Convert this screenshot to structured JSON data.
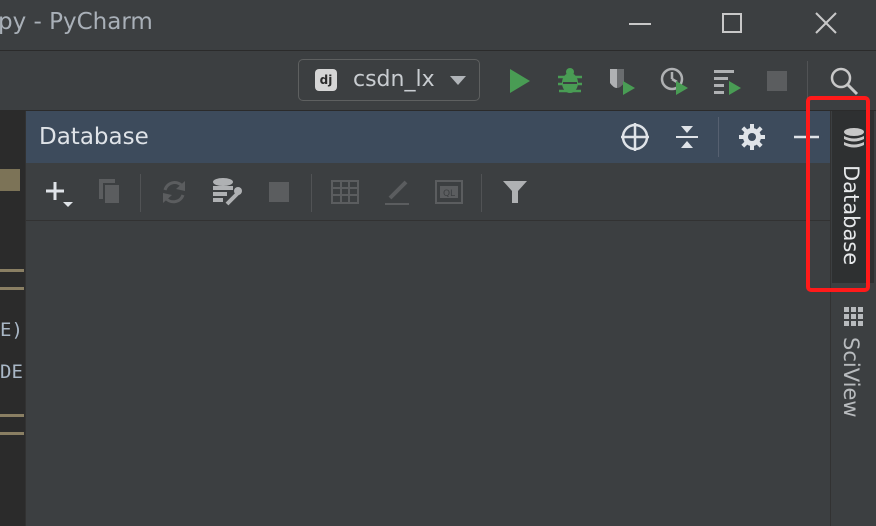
{
  "window": {
    "title": "py - PyCharm"
  },
  "navbar": {
    "run_config": {
      "badge": "dj",
      "label": "csdn_lx"
    }
  },
  "editor": {
    "visible_fragments": [
      "E)",
      "DE"
    ]
  },
  "database_panel": {
    "title": "Database"
  },
  "right_stripe": {
    "tabs": [
      {
        "label": "Database",
        "icon": "database-icon",
        "active": true
      },
      {
        "label": "SciView",
        "icon": "grid-icon",
        "active": false
      }
    ]
  },
  "colors": {
    "run_green": "#499c54",
    "highlight_red": "#ff1a1a",
    "panel_header": "#3d4b5c"
  }
}
